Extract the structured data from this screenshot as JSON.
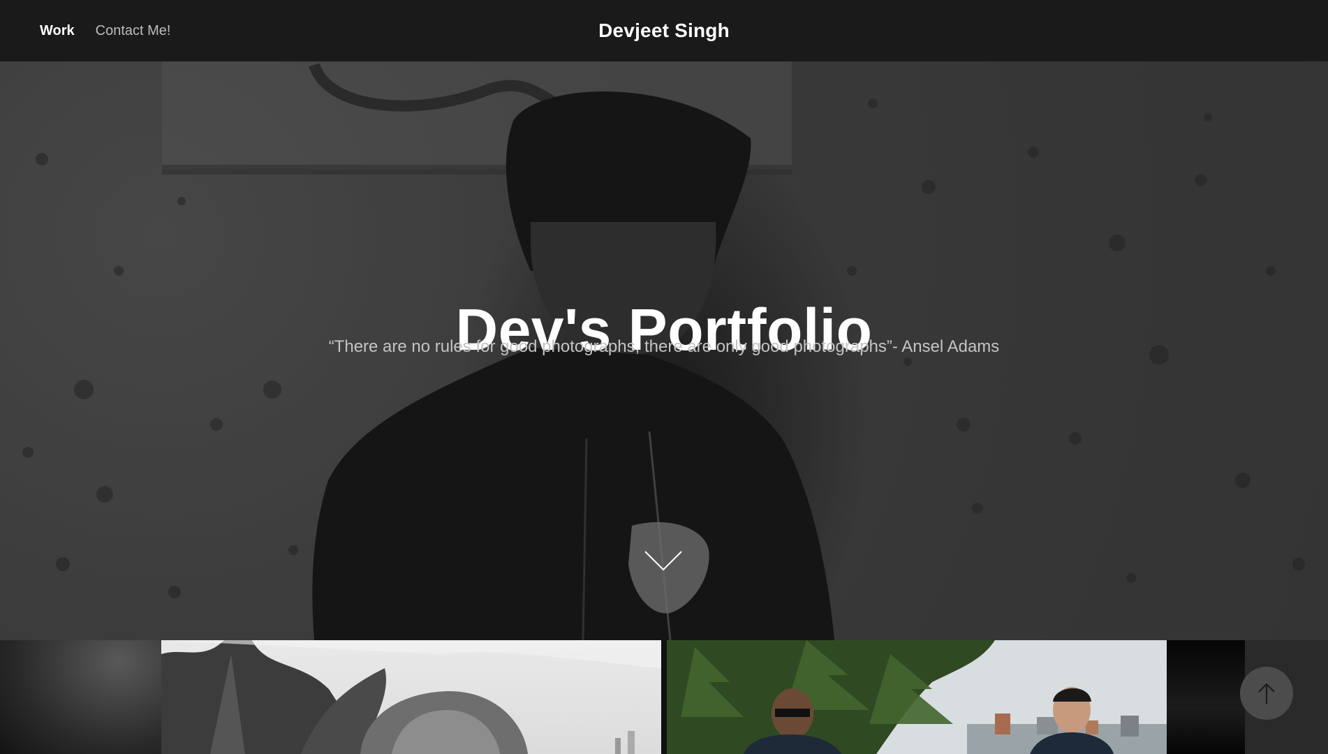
{
  "header": {
    "nav": [
      {
        "label": "Work",
        "active": true
      },
      {
        "label": "Contact Me!",
        "active": false
      }
    ],
    "site_title": "Devjeet Singh"
  },
  "hero": {
    "title": "Dev's Portfolio",
    "quote": "“There are no rules for good photographs, there are only good photographs”- Ansel Adams",
    "scroll_icon": "chevron-down-icon"
  },
  "gallery": {
    "items": [
      {
        "description": "black-and-white portrait thumbnail (partial)"
      },
      {
        "description": "black-and-white portrait with trees"
      },
      {
        "description": "color photo of two men with trees and city skyline"
      },
      {
        "description": "dark thumbnail (partial)"
      }
    ]
  },
  "back_to_top": {
    "icon": "arrow-up-icon"
  },
  "colors": {
    "header_bg": "#1a1a1a",
    "text_primary": "#ffffff",
    "text_muted": "#bdbdbd",
    "button_bg": "#4c4c4c"
  }
}
